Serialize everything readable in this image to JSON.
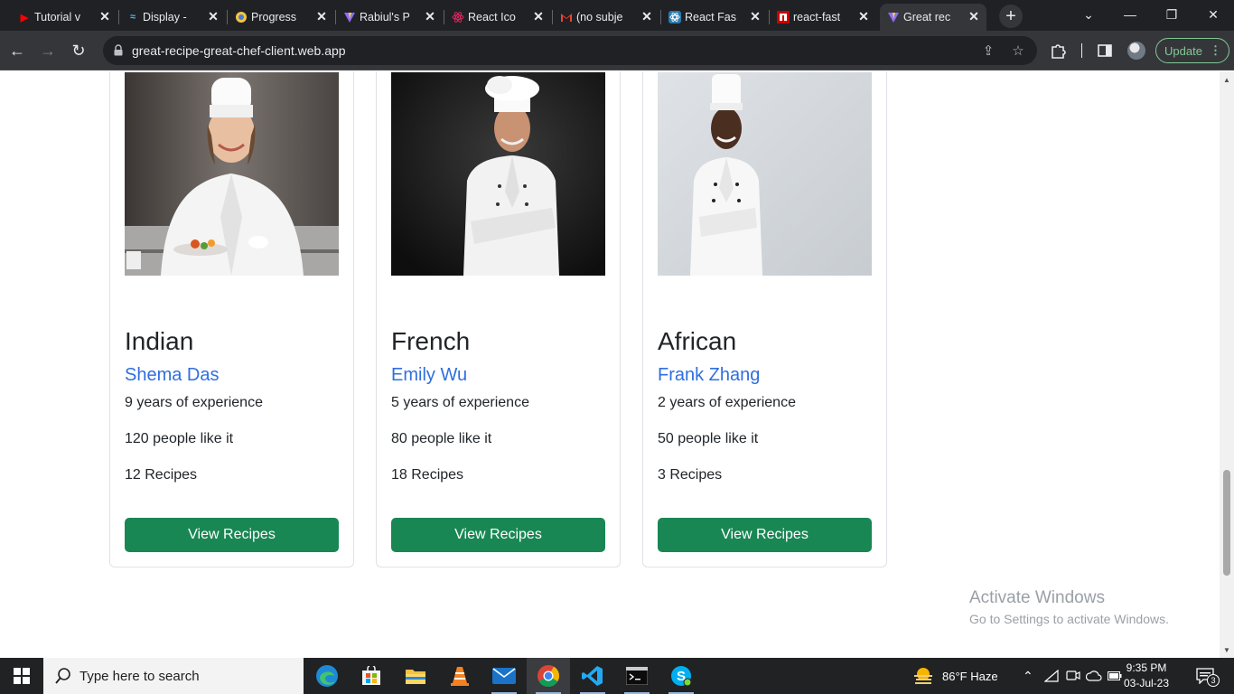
{
  "browser": {
    "tabs": [
      {
        "title": "Tutorial v",
        "icon": "youtube-icon",
        "active": false
      },
      {
        "title": "Display -",
        "icon": "tailwind-icon",
        "active": false
      },
      {
        "title": "Progress",
        "icon": "progress-icon",
        "active": false
      },
      {
        "title": "Rabiul's P",
        "icon": "vite-icon",
        "active": false
      },
      {
        "title": "React Ico",
        "icon": "react-icon",
        "active": false
      },
      {
        "title": "(no subje",
        "icon": "gmail-icon",
        "active": false
      },
      {
        "title": "React Fas",
        "icon": "react-icon",
        "active": false
      },
      {
        "title": "react-fast",
        "icon": "npm-icon",
        "active": false
      },
      {
        "title": "Great rec",
        "icon": "vite-icon",
        "active": true
      }
    ],
    "url": "great-recipe-great-chef-client.web.app",
    "update_label": "Update"
  },
  "chefs": [
    {
      "cuisine": "Indian",
      "name": "Shema Das",
      "experience": "9 years of experience",
      "likes": "120 people like it",
      "recipes": "12 Recipes",
      "button": "View Recipes"
    },
    {
      "cuisine": "French",
      "name": "Emily Wu",
      "experience": "5 years of experience",
      "likes": "80 people like it",
      "recipes": "18 Recipes",
      "button": "View Recipes"
    },
    {
      "cuisine": "African",
      "name": "Frank Zhang",
      "experience": "2 years of experience",
      "likes": "50 people like it",
      "recipes": "3 Recipes",
      "button": "View Recipes"
    }
  ],
  "watermark": {
    "line1": "Activate Windows",
    "line2": "Go to Settings to activate Windows."
  },
  "taskbar": {
    "search_placeholder": "Type here to search",
    "weather": "86°F  Haze",
    "time": "9:35 PM",
    "date": "03-Jul-23",
    "notification_count": "3"
  }
}
